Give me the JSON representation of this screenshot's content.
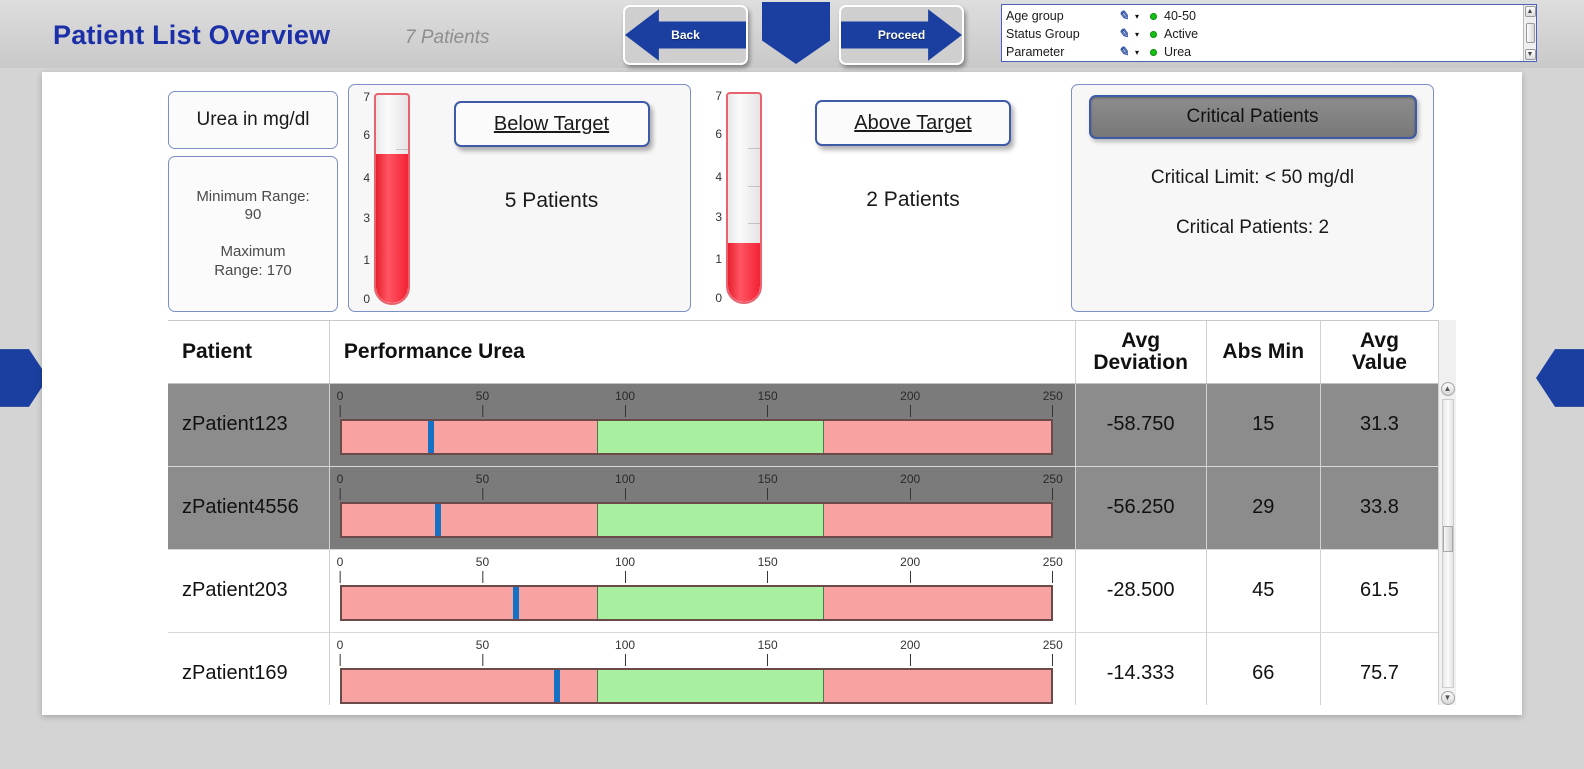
{
  "header": {
    "title": "Patient List Overview",
    "patient_count": "7 Patients",
    "back_label": "Back",
    "proceed_label": "Proceed"
  },
  "filters": {
    "rows": [
      {
        "label": "Age group",
        "value": "40-50",
        "pencil": "pencil-icon",
        "caret": "▾",
        "status_color": "#15c215"
      },
      {
        "label": "Status Group",
        "value": "Active",
        "pencil": "pencil-icon",
        "caret": "▾",
        "status_color": "#15c215"
      },
      {
        "label": "Parameter",
        "value": "Urea",
        "pencil": "pencil-icon",
        "caret": "▾",
        "status_color": "#15c215"
      }
    ]
  },
  "parameter_panel": {
    "title": "Urea in mg/dl",
    "minimum_label": "Minimum Range:",
    "minimum_value": "90",
    "maximum_label": "Maximum",
    "maximum_value": "Range: 170"
  },
  "below_target": {
    "button_label": "Below Target",
    "count_label": "5 Patients",
    "gauge": {
      "axis_labels": [
        "7",
        "6",
        "4",
        "3",
        "1",
        "0"
      ],
      "axis_positions_pct": [
        2,
        20,
        40,
        59,
        79,
        97
      ],
      "fill_value": 5,
      "max": 7
    }
  },
  "above_target": {
    "button_label": "Above Target",
    "count_label": "2 Patients",
    "gauge": {
      "axis_labels": [
        "7",
        "6",
        "4",
        "3",
        "1",
        "0"
      ],
      "axis_positions_pct": [
        2,
        20,
        40,
        59,
        79,
        97
      ],
      "fill_value": 2,
      "max": 7
    }
  },
  "critical": {
    "button_label": "Critical Patients",
    "limit_line": "Critical Limit: < 50 mg/dl",
    "count_line": "Critical Patients: 2"
  },
  "table": {
    "columns": [
      "Patient",
      "Performance Urea",
      "Avg Deviation",
      "Abs Min",
      "Avg Value"
    ],
    "axis_ticks": [
      0,
      50,
      100,
      150,
      200,
      250
    ],
    "axis_max": 250,
    "target_band": {
      "min": 90,
      "max": 170
    },
    "rows": [
      {
        "patient": "zPatient123",
        "avg_deviation": "-58.750",
        "abs_min": "15",
        "avg_value": "31.3",
        "marker": 31.3,
        "critical": true
      },
      {
        "patient": "zPatient4556",
        "avg_deviation": "-56.250",
        "abs_min": "29",
        "avg_value": "33.8",
        "marker": 33.8,
        "critical": true
      },
      {
        "patient": "zPatient203",
        "avg_deviation": "-28.500",
        "abs_min": "45",
        "avg_value": "61.5",
        "marker": 61.5,
        "critical": false
      },
      {
        "patient": "zPatient169",
        "avg_deviation": "-14.333",
        "abs_min": "66",
        "avg_value": "75.7",
        "marker": 75.7,
        "critical": false
      }
    ]
  },
  "colors": {
    "brand_blue": "#1b3fa0",
    "title_blue": "#1b2fa8",
    "below_range": "#f8a2a2",
    "in_range": "#a8f0a0",
    "marker_blue": "#1471c4",
    "critical_row": "#8c8c8c",
    "gauge_red": "#f32235"
  }
}
